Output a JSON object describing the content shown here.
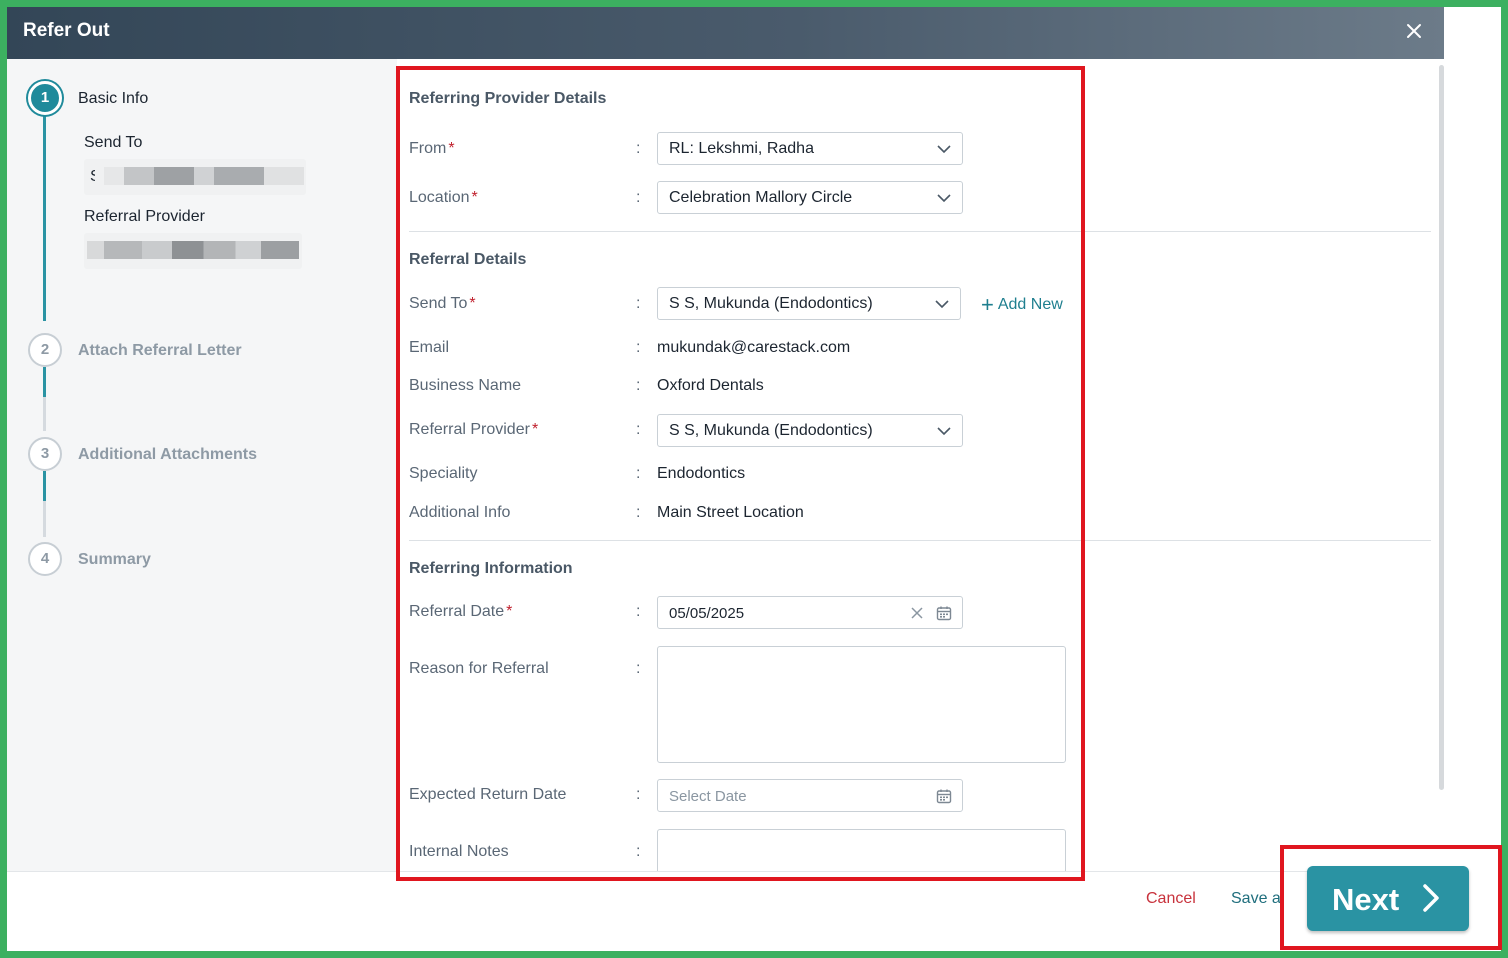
{
  "dialog": {
    "title": "Refer Out"
  },
  "steps": [
    {
      "number": "1",
      "label": "Basic Info"
    },
    {
      "number": "2",
      "label": "Attach Referral Letter"
    },
    {
      "number": "3",
      "label": "Additional Attachments"
    },
    {
      "number": "4",
      "label": "Summary"
    }
  ],
  "step_summary": {
    "send_to_label": "Send To",
    "send_to_value_prefix": "S",
    "referral_provider_label": "Referral Provider"
  },
  "referring_provider": {
    "section_title": "Referring Provider Details",
    "from_label": "From",
    "from_value": "RL: Lekshmi, Radha",
    "location_label": "Location",
    "location_value": "Celebration Mallory Circle"
  },
  "referral_details": {
    "section_title": "Referral Details",
    "send_to_label": "Send To",
    "send_to_value": "S S, Mukunda (Endodontics)",
    "add_new_label": "Add New",
    "email_label": "Email",
    "email_value": "mukundak@carestack.com",
    "business_name_label": "Business Name",
    "business_name_value": "Oxford Dentals",
    "referral_provider_label": "Referral Provider",
    "referral_provider_value": "S S, Mukunda (Endodontics)",
    "speciality_label": "Speciality",
    "speciality_value": "Endodontics",
    "additional_info_label": "Additional Info",
    "additional_info_value": "Main Street Location"
  },
  "referring_information": {
    "section_title": "Referring Information",
    "referral_date_label": "Referral Date",
    "referral_date_value": "05/05/2025",
    "reason_label": "Reason for Referral",
    "reason_value": "",
    "expected_return_label": "Expected Return Date",
    "expected_return_placeholder": "Select Date",
    "internal_notes_label": "Internal Notes",
    "internal_notes_value": ""
  },
  "footer": {
    "cancel_label": "Cancel",
    "save_label": "Save a",
    "next_label": "Next"
  },
  "colors": {
    "accent": "#2a93a3",
    "header": "#3e5063",
    "required": "#c0202d",
    "highlight_box": "#e0161f",
    "outer_border": "#3cb060"
  }
}
